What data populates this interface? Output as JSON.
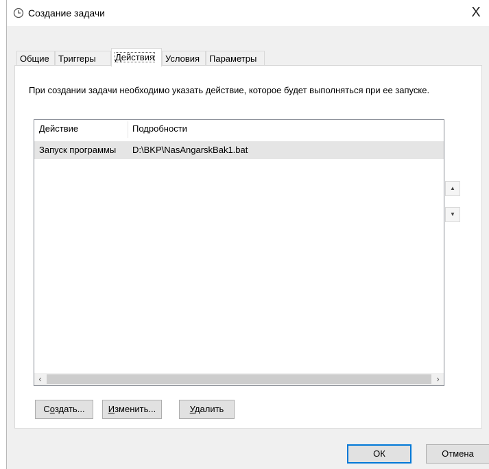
{
  "window": {
    "title": "Создание задачи",
    "title_icon": "clock-icon",
    "close_label": "X"
  },
  "tabs": [
    {
      "label": "Общие",
      "active": false
    },
    {
      "label": "Триггеры",
      "active": false
    },
    {
      "label": "Действия",
      "active": true
    },
    {
      "label": "Условия",
      "active": false
    },
    {
      "label": "Параметры",
      "active": false
    }
  ],
  "panel": {
    "description": "При создании задачи необходимо указать действие, которое будет выполняться при ее запуске."
  },
  "list": {
    "columns": [
      "Действие",
      "Подробности"
    ],
    "rows": [
      {
        "action": "Запуск программы",
        "details": "D:\\BKP\\NasAngarskBak1.bat",
        "selected": true
      }
    ]
  },
  "side_buttons": {
    "up_icon": "move-up-icon",
    "down_icon": "move-down-icon"
  },
  "actions": {
    "create_pre": "С",
    "create_ul": "о",
    "create_post": "здать...",
    "edit_ul": "И",
    "edit_post": "зменить...",
    "delete_ul": "У",
    "delete_post": "далить"
  },
  "footer": {
    "ok_label": "ОК",
    "cancel_label": "Отмена"
  }
}
